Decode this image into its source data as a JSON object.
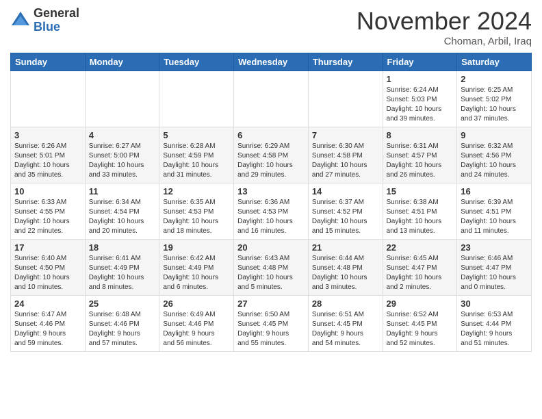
{
  "logo": {
    "general": "General",
    "blue": "Blue"
  },
  "title": "November 2024",
  "location": "Choman, Arbil, Iraq",
  "days_of_week": [
    "Sunday",
    "Monday",
    "Tuesday",
    "Wednesday",
    "Thursday",
    "Friday",
    "Saturday"
  ],
  "weeks": [
    [
      {
        "day": "",
        "info": ""
      },
      {
        "day": "",
        "info": ""
      },
      {
        "day": "",
        "info": ""
      },
      {
        "day": "",
        "info": ""
      },
      {
        "day": "",
        "info": ""
      },
      {
        "day": "1",
        "info": "Sunrise: 6:24 AM\nSunset: 5:03 PM\nDaylight: 10 hours\nand 39 minutes."
      },
      {
        "day": "2",
        "info": "Sunrise: 6:25 AM\nSunset: 5:02 PM\nDaylight: 10 hours\nand 37 minutes."
      }
    ],
    [
      {
        "day": "3",
        "info": "Sunrise: 6:26 AM\nSunset: 5:01 PM\nDaylight: 10 hours\nand 35 minutes."
      },
      {
        "day": "4",
        "info": "Sunrise: 6:27 AM\nSunset: 5:00 PM\nDaylight: 10 hours\nand 33 minutes."
      },
      {
        "day": "5",
        "info": "Sunrise: 6:28 AM\nSunset: 4:59 PM\nDaylight: 10 hours\nand 31 minutes."
      },
      {
        "day": "6",
        "info": "Sunrise: 6:29 AM\nSunset: 4:58 PM\nDaylight: 10 hours\nand 29 minutes."
      },
      {
        "day": "7",
        "info": "Sunrise: 6:30 AM\nSunset: 4:58 PM\nDaylight: 10 hours\nand 27 minutes."
      },
      {
        "day": "8",
        "info": "Sunrise: 6:31 AM\nSunset: 4:57 PM\nDaylight: 10 hours\nand 26 minutes."
      },
      {
        "day": "9",
        "info": "Sunrise: 6:32 AM\nSunset: 4:56 PM\nDaylight: 10 hours\nand 24 minutes."
      }
    ],
    [
      {
        "day": "10",
        "info": "Sunrise: 6:33 AM\nSunset: 4:55 PM\nDaylight: 10 hours\nand 22 minutes."
      },
      {
        "day": "11",
        "info": "Sunrise: 6:34 AM\nSunset: 4:54 PM\nDaylight: 10 hours\nand 20 minutes."
      },
      {
        "day": "12",
        "info": "Sunrise: 6:35 AM\nSunset: 4:53 PM\nDaylight: 10 hours\nand 18 minutes."
      },
      {
        "day": "13",
        "info": "Sunrise: 6:36 AM\nSunset: 4:53 PM\nDaylight: 10 hours\nand 16 minutes."
      },
      {
        "day": "14",
        "info": "Sunrise: 6:37 AM\nSunset: 4:52 PM\nDaylight: 10 hours\nand 15 minutes."
      },
      {
        "day": "15",
        "info": "Sunrise: 6:38 AM\nSunset: 4:51 PM\nDaylight: 10 hours\nand 13 minutes."
      },
      {
        "day": "16",
        "info": "Sunrise: 6:39 AM\nSunset: 4:51 PM\nDaylight: 10 hours\nand 11 minutes."
      }
    ],
    [
      {
        "day": "17",
        "info": "Sunrise: 6:40 AM\nSunset: 4:50 PM\nDaylight: 10 hours\nand 10 minutes."
      },
      {
        "day": "18",
        "info": "Sunrise: 6:41 AM\nSunset: 4:49 PM\nDaylight: 10 hours\nand 8 minutes."
      },
      {
        "day": "19",
        "info": "Sunrise: 6:42 AM\nSunset: 4:49 PM\nDaylight: 10 hours\nand 6 minutes."
      },
      {
        "day": "20",
        "info": "Sunrise: 6:43 AM\nSunset: 4:48 PM\nDaylight: 10 hours\nand 5 minutes."
      },
      {
        "day": "21",
        "info": "Sunrise: 6:44 AM\nSunset: 4:48 PM\nDaylight: 10 hours\nand 3 minutes."
      },
      {
        "day": "22",
        "info": "Sunrise: 6:45 AM\nSunset: 4:47 PM\nDaylight: 10 hours\nand 2 minutes."
      },
      {
        "day": "23",
        "info": "Sunrise: 6:46 AM\nSunset: 4:47 PM\nDaylight: 10 hours\nand 0 minutes."
      }
    ],
    [
      {
        "day": "24",
        "info": "Sunrise: 6:47 AM\nSunset: 4:46 PM\nDaylight: 9 hours\nand 59 minutes."
      },
      {
        "day": "25",
        "info": "Sunrise: 6:48 AM\nSunset: 4:46 PM\nDaylight: 9 hours\nand 57 minutes."
      },
      {
        "day": "26",
        "info": "Sunrise: 6:49 AM\nSunset: 4:46 PM\nDaylight: 9 hours\nand 56 minutes."
      },
      {
        "day": "27",
        "info": "Sunrise: 6:50 AM\nSunset: 4:45 PM\nDaylight: 9 hours\nand 55 minutes."
      },
      {
        "day": "28",
        "info": "Sunrise: 6:51 AM\nSunset: 4:45 PM\nDaylight: 9 hours\nand 54 minutes."
      },
      {
        "day": "29",
        "info": "Sunrise: 6:52 AM\nSunset: 4:45 PM\nDaylight: 9 hours\nand 52 minutes."
      },
      {
        "day": "30",
        "info": "Sunrise: 6:53 AM\nSunset: 4:44 PM\nDaylight: 9 hours\nand 51 minutes."
      }
    ]
  ]
}
